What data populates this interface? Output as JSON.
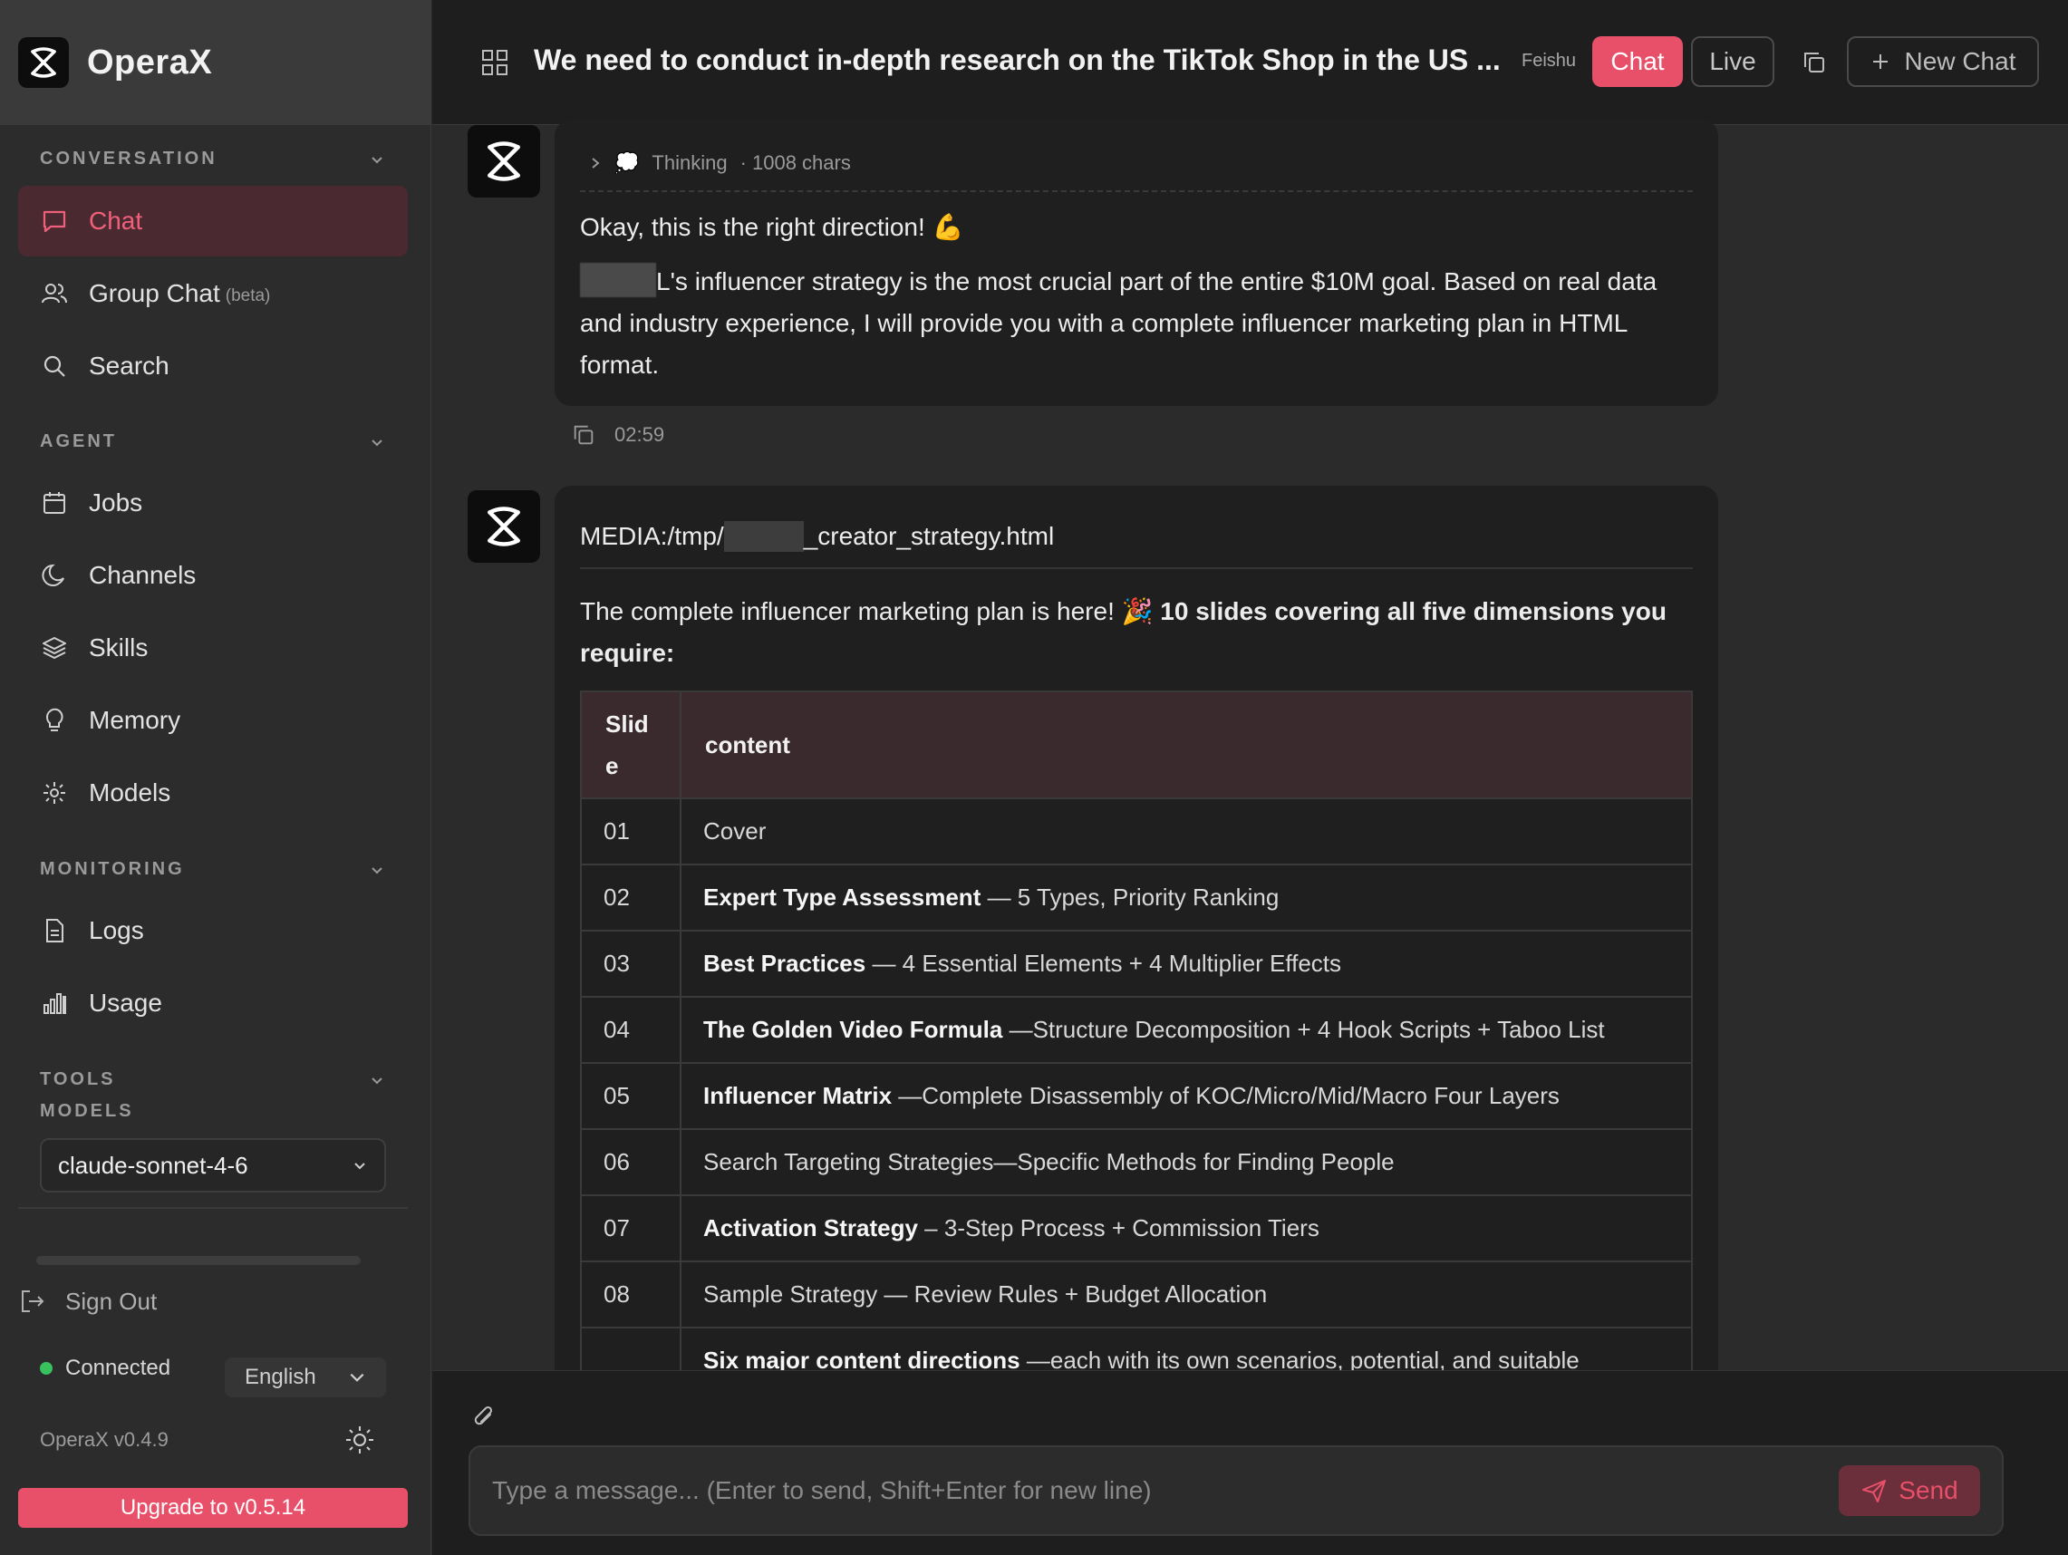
{
  "app": {
    "name": "OperaX",
    "version": "OperaX v0.4.9"
  },
  "sidebar": {
    "sections": {
      "conversation": "CONVERSATION",
      "agent": "AGENT",
      "monitoring": "MONITORING",
      "tools": "TOOLS",
      "models": "MODELS"
    },
    "items": {
      "chat": "Chat",
      "group_chat": "Group Chat",
      "group_chat_badge": "(beta)",
      "search": "Search",
      "jobs": "Jobs",
      "channels": "Channels",
      "skills": "Skills",
      "memory": "Memory",
      "models": "Models",
      "logs": "Logs",
      "usage": "Usage"
    },
    "model_selected": "claude-sonnet-4-6",
    "sign_out": "Sign Out",
    "status": "Connected",
    "language": "English",
    "upgrade": "Upgrade to v0.5.14"
  },
  "header": {
    "title": "We need to conduct in-depth research on the TikTok Shop in the US ...",
    "feishu": "Feishu",
    "chat_btn": "Chat",
    "live_btn": "Live",
    "new_chat": "New Chat"
  },
  "messages": [
    {
      "thinking_label": "Thinking",
      "thinking_chars": "· 1008 chars",
      "line1": "Okay, this is the right direction! 💪",
      "line2_suffix": "L's influencer strategy is the most crucial part of the entire $10M goal. Based on real data and industry experience, I will provide you with a complete influencer marketing plan in HTML format.",
      "time": "02:59"
    },
    {
      "media_prefix": "MEDIA:/tmp/",
      "media_suffix": "_creator_strategy.html",
      "intro_plain": "The complete influencer marketing plan is here! 🎉 ",
      "intro_bold": "10 slides covering all five dimensions you require:"
    }
  ],
  "table": {
    "headers": [
      "Slid e",
      "content"
    ],
    "rows": [
      {
        "num": "01",
        "bold": "",
        "text": "Cover"
      },
      {
        "num": "02",
        "bold": "Expert Type Assessment",
        "text": " — 5 Types, Priority Ranking"
      },
      {
        "num": "03",
        "bold": "Best Practices",
        "text": " — 4 Essential Elements + 4 Multiplier Effects"
      },
      {
        "num": "04",
        "bold": "The Golden Video Formula",
        "text": " —Structure Decomposition + 4 Hook Scripts + Taboo List"
      },
      {
        "num": "05",
        "bold": "Influencer Matrix",
        "text": " —Complete Disassembly of KOC/Micro/Mid/Macro Four Layers"
      },
      {
        "num": "06",
        "bold": "",
        "text": "Search Targeting Strategies—Specific Methods for Finding People"
      },
      {
        "num": "07",
        "bold": "Activation Strategy",
        "text": " – 3-Step Process + Commission Tiers"
      },
      {
        "num": "08",
        "bold": "",
        "text": "Sample Strategy — Review Rules + Budget Allocation"
      },
      {
        "num": "",
        "bold": "Six major content directions",
        "text": " —each with its own scenarios, potential, and suitable"
      }
    ]
  },
  "composer": {
    "placeholder": "Type a message... (Enter to send, Shift+Enter for new line)",
    "send": "Send"
  },
  "colors": {
    "accent": "#e8506a",
    "status_green": "#37c25e"
  }
}
